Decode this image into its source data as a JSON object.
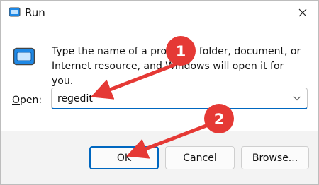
{
  "window": {
    "title": "Run",
    "icon": "run-app-icon",
    "close_icon": "close-icon"
  },
  "main": {
    "icon": "run-dialog-icon",
    "description": "Type the name of a program, folder, document, or Internet resource, and Windows will open it for you.",
    "open_label_accel": "O",
    "open_label_rest": "pen:",
    "open_value": "regedit"
  },
  "buttons": {
    "ok_label": "OK",
    "cancel_label": "Cancel",
    "browse_label_accel": "B",
    "browse_label_rest": "rowse..."
  },
  "annotations": {
    "step1": "1",
    "step2": "2",
    "color": "#e53935"
  },
  "colors": {
    "accent": "#0067c0",
    "icon_blue": "#1e88e5"
  }
}
